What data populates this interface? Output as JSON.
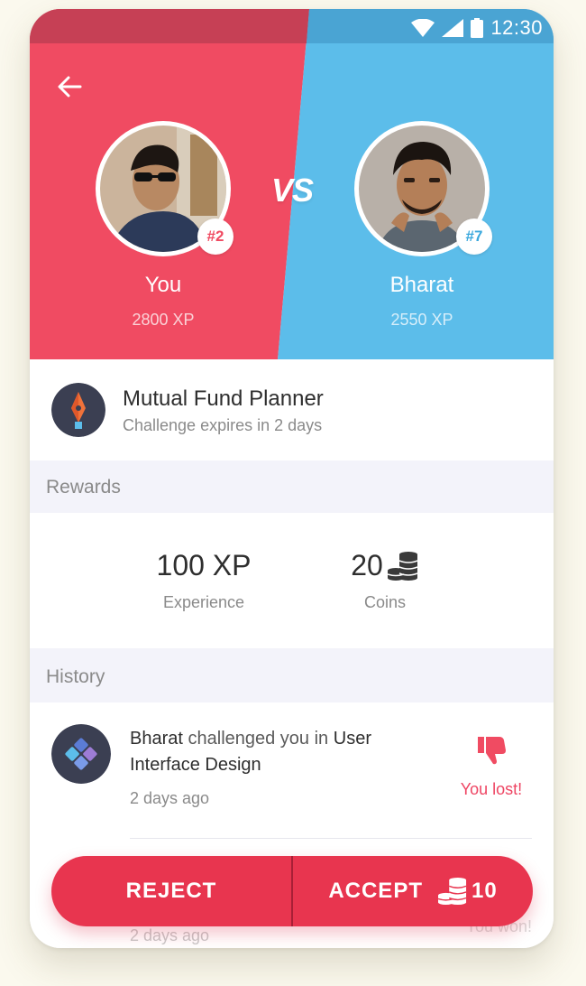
{
  "status_bar": {
    "time": "12:30"
  },
  "players": {
    "left": {
      "name": "You",
      "xp": "2800 XP",
      "rank": "#2"
    },
    "right": {
      "name": "Bharat",
      "xp": "2550 XP",
      "rank": "#7"
    },
    "vs_label": "VS"
  },
  "challenge": {
    "title": "Mutual Fund Planner",
    "subtitle": "Challenge expires in 2 days"
  },
  "rewards": {
    "section_label": "Rewards",
    "experience_value": "100 XP",
    "experience_label": "Experience",
    "coins_value": "20",
    "coins_label": "Coins"
  },
  "history": {
    "section_label": "History",
    "items": [
      {
        "actor": "Bharat",
        "text": "challenged you in",
        "topic": "User Interface Design",
        "time": "2 days ago",
        "result": "You lost!"
      },
      {
        "time": "2 days ago",
        "result": "You won!"
      }
    ]
  },
  "actions": {
    "reject_label": "REJECT",
    "accept_label": "ACCEPT",
    "accept_cost": "10"
  },
  "colors": {
    "red": "#f04b62",
    "blue": "#5cbdea",
    "accent": "#e8354f"
  }
}
